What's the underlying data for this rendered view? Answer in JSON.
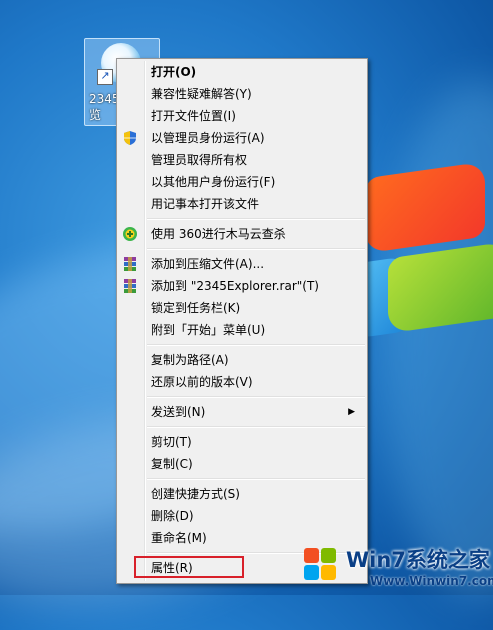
{
  "desktop": {
    "icon_label": "2345\n览"
  },
  "context_menu": {
    "groups": [
      [
        {
          "label": "打开(O)",
          "bold": true
        },
        {
          "label": "兼容性疑难解答(Y)"
        },
        {
          "label": "打开文件位置(I)"
        },
        {
          "label": "以管理员身份运行(A)",
          "icon": "uac-shield-icon"
        },
        {
          "label": "管理员取得所有权"
        },
        {
          "label": "以其他用户身份运行(F)"
        },
        {
          "label": "用记事本打开该文件"
        }
      ],
      [
        {
          "label": "使用 360进行木马云查杀",
          "icon": "360-security-icon"
        }
      ],
      [
        {
          "label": "添加到压缩文件(A)...",
          "icon": "winrar-icon"
        },
        {
          "label": "添加到 \"2345Explorer.rar\"(T)",
          "icon": "winrar-icon"
        },
        {
          "label": "锁定到任务栏(K)"
        },
        {
          "label": "附到「开始」菜单(U)"
        }
      ],
      [
        {
          "label": "复制为路径(A)"
        },
        {
          "label": "还原以前的版本(V)"
        }
      ],
      [
        {
          "label": "发送到(N)",
          "submenu": true
        }
      ],
      [
        {
          "label": "剪切(T)"
        },
        {
          "label": "复制(C)"
        }
      ],
      [
        {
          "label": "创建快捷方式(S)"
        },
        {
          "label": "删除(D)"
        },
        {
          "label": "重命名(M)"
        }
      ],
      [
        {
          "label": "属性(R)"
        }
      ]
    ]
  },
  "watermark": {
    "title": "Win7系统之家",
    "url": "Www.Winwin7.com"
  },
  "colors": {
    "highlight_border": "#d8202a",
    "menu_bg": "#f0f0f0"
  }
}
